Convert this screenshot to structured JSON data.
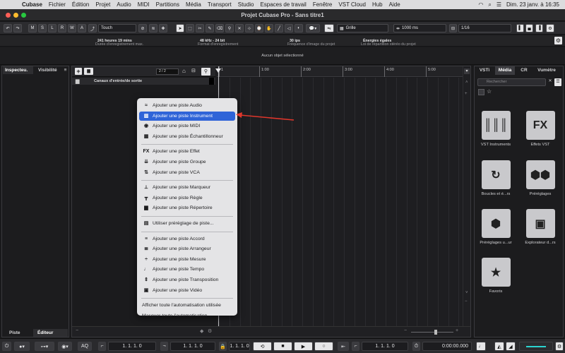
{
  "menubar": {
    "app": "Cubase",
    "items": [
      "Fichier",
      "Édition",
      "Projet",
      "Audio",
      "MIDI",
      "Partitions",
      "Média",
      "Transport",
      "Studio",
      "Espaces de travail",
      "Fenêtre",
      "VST Cloud",
      "Hub",
      "Aide"
    ],
    "clock": "Dim. 23 janv. à 16:35"
  },
  "window": {
    "title": "Projet Cubase Pro - Sans titre1"
  },
  "toolbar": {
    "modes": [
      "M",
      "S",
      "L",
      "R",
      "W",
      "A"
    ],
    "automation_mode": "Touch",
    "grid_type": "Grille",
    "grid_size": "1000 ms",
    "quantize": "1/16"
  },
  "infoline": {
    "max_record_label": "Durée d'enregistrement max.",
    "max_record_value": "241 heures 19 mins",
    "format_label": "Format d'enregistrement",
    "format_value": "48 kHz - 24 bit",
    "framerate_label": "Fréquence d'image du projet",
    "framerate_value": "30 ips",
    "pan_label": "Loi de répartition stéréo du projet",
    "pan_value": "Énergies égales"
  },
  "status": {
    "no_object": "Aucun objet sélectionné"
  },
  "inspector": {
    "tab_inspector": "Inspecteu.",
    "tab_visibility": "Visibilité",
    "tab_track": "Piste",
    "tab_editor": "Éditeur"
  },
  "project": {
    "track_counter": "2 / 2",
    "folder_label": "Canaux d'entrée/de sortie",
    "ruler_marks": [
      "1",
      "1:00",
      "2:00",
      "3:00",
      "4:00",
      "5:00"
    ]
  },
  "context_menu": {
    "groups": [
      [
        {
          "label": "Ajouter une piste Audio",
          "icon": "audio-wave-icon",
          "highlight": false
        },
        {
          "label": "Ajouter une piste Instrument",
          "icon": "keyboard-icon",
          "highlight": true
        },
        {
          "label": "Ajouter une piste MIDI",
          "icon": "midi-icon",
          "highlight": false
        },
        {
          "label": "Ajouter une piste Échantillonneur",
          "icon": "sampler-icon",
          "highlight": false
        }
      ],
      [
        {
          "label": "Ajouter une piste Effet",
          "icon": "fx-icon",
          "highlight": false
        },
        {
          "label": "Ajouter une piste Groupe",
          "icon": "group-icon",
          "highlight": false
        },
        {
          "label": "Ajouter une piste VCA",
          "icon": "vca-icon",
          "highlight": false
        }
      ],
      [
        {
          "label": "Ajouter une piste Marqueur",
          "icon": "marker-icon",
          "highlight": false
        },
        {
          "label": "Ajouter une piste Règle",
          "icon": "ruler-icon",
          "highlight": false
        },
        {
          "label": "Ajouter une piste Répertoire",
          "icon": "folder-icon",
          "highlight": false
        }
      ],
      [
        {
          "label": "Utiliser préréglage de piste...",
          "icon": "preset-icon",
          "highlight": false
        }
      ],
      [
        {
          "label": "Ajouter une piste Accord",
          "icon": "chord-icon",
          "highlight": false
        },
        {
          "label": "Ajouter une piste Arrangeur",
          "icon": "arranger-icon",
          "highlight": false
        },
        {
          "label": "Ajouter une piste Mesure",
          "icon": "signature-icon",
          "highlight": false
        },
        {
          "label": "Ajouter une piste Tempo",
          "icon": "tempo-icon",
          "highlight": false
        },
        {
          "label": "Ajouter une piste Transposition",
          "icon": "transpose-icon",
          "highlight": false
        },
        {
          "label": "Ajouter une piste Vidéo",
          "icon": "video-icon",
          "highlight": false
        }
      ],
      [
        {
          "label": "Afficher toute l'automatisation utilisée",
          "icon": "",
          "highlight": false
        },
        {
          "label": "Masquer toute l'automatisation",
          "icon": "",
          "highlight": false
        }
      ]
    ]
  },
  "mediabay": {
    "tabs": [
      "VSTi",
      "Média",
      "CR",
      "Vumètre"
    ],
    "active_tab": "Média",
    "search_placeholder": "Rechercher",
    "tiles": [
      {
        "label": "VST Instruments",
        "icon": "piano-keys-icon",
        "glyph": "║║║"
      },
      {
        "label": "Effets VST",
        "icon": "fx-icon",
        "glyph": "FX"
      },
      {
        "label": "Boucles et é...rs",
        "icon": "loop-icon",
        "glyph": "↻"
      },
      {
        "label": "Préréglages",
        "icon": "hexagons-icon",
        "glyph": "⬢⬢"
      },
      {
        "label": "Préréglages u...ur",
        "icon": "user-preset-icon",
        "glyph": "⬢"
      },
      {
        "label": "Explorateur d...rs",
        "icon": "browser-icon",
        "glyph": "▣"
      },
      {
        "label": "Favoris",
        "icon": "star-icon",
        "glyph": "★"
      }
    ]
  },
  "transport": {
    "left_locator": "1. 1. 1. 0",
    "right_locator": "1. 1. 1. 0",
    "position": "1. 1. 1. 0",
    "time": "0:00:00.000",
    "aq_label": "AQ"
  },
  "annotation": {
    "arrow_color": "#e0362b"
  }
}
